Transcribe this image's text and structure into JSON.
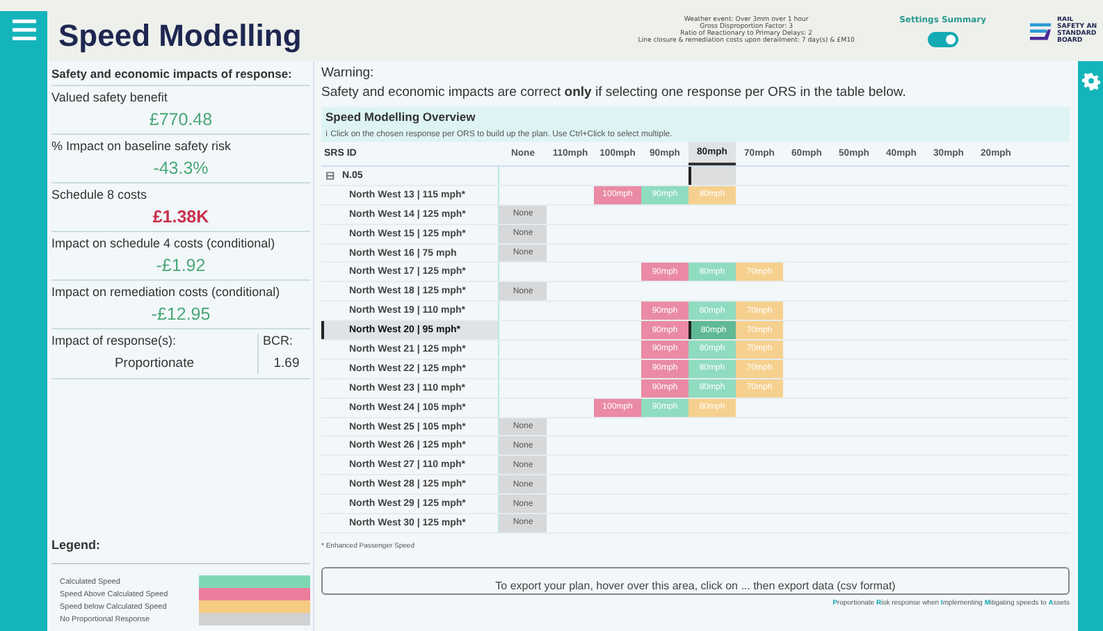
{
  "header": {
    "title": "Speed Modelling",
    "settings_lines": [
      "Weather event: Over 3mm over 1 hour",
      "Gross Disproportion Factor: 3",
      "Ratio of Reactionary to Primary Delays: 2",
      "Line closure & remediation costs upon derailment: 7 day(s) & £M10"
    ],
    "settings_label": "Settings Summary",
    "settings_toggle": {
      "on": true
    },
    "logo_lines": [
      "RAIL",
      "SAFETY AN",
      "STANDARD",
      "BOARD"
    ]
  },
  "impacts": {
    "title": "Safety and economic impacts of response:",
    "metrics": [
      {
        "label": "Valued safety benefit",
        "value": "£770.48",
        "adverse": false
      },
      {
        "label": "% Impact on baseline safety risk",
        "value": "-43.3%",
        "adverse": false
      },
      {
        "label": "Schedule 8 costs",
        "value": "£1.38K",
        "adverse": true
      },
      {
        "label": "Impact on schedule 4 costs (conditional)",
        "value": "-£1.92",
        "adverse": false
      },
      {
        "label": "Impact on remediation costs (conditional)",
        "value": "-£12.95",
        "adverse": false
      }
    ],
    "response_label": "Impact of response(s):",
    "response_value": "Proportionate",
    "bcr_label": "BCR:",
    "bcr_value": "1.69"
  },
  "legend": {
    "title": "Legend:",
    "items": [
      {
        "label": "Calculated Speed",
        "color": "#7fd8b4"
      },
      {
        "label": "Speed Above Calculated Speed",
        "color": "#ea7e9c"
      },
      {
        "label": "Speed below Calculated Speed",
        "color": "#f6cb82"
      },
      {
        "label": "No Proportional Response",
        "color": "#cfd1d3"
      }
    ]
  },
  "warning": {
    "title": "Warning:",
    "text": "Safety and economic impacts are correct **only** if selecting one response per ORS in the table below."
  },
  "overview": {
    "title": "Speed Modelling Overview",
    "hint": "ℹ Click on the chosen response per ORS to build up the plan. Use Ctrl+Click to select multiple.",
    "id_header": "SRS ID",
    "columns": [
      {
        "label": "None",
        "selected": false
      },
      {
        "label": "110mph",
        "selected": false
      },
      {
        "label": "100mph",
        "selected": false
      },
      {
        "label": "90mph",
        "selected": false
      },
      {
        "label": "80mph",
        "selected": true
      },
      {
        "label": "70mph",
        "selected": false
      },
      {
        "label": "60mph",
        "selected": false
      },
      {
        "label": "50mph",
        "selected": false
      },
      {
        "label": "40mph",
        "selected": false
      },
      {
        "label": "30mph",
        "selected": false
      },
      {
        "label": "20mph",
        "selected": false
      }
    ],
    "group": {
      "label": "N.05",
      "expanded": true,
      "toggle": "⊟",
      "cells": [
        {
          "kind": "blank"
        },
        {
          "kind": "blank"
        },
        {
          "kind": "blank"
        },
        {
          "kind": "blank"
        },
        {
          "kind": "focus"
        },
        {
          "kind": "blank"
        },
        {
          "kind": "blank"
        },
        {
          "kind": "blank"
        },
        {
          "kind": "blank"
        },
        {
          "kind": "blank"
        },
        {
          "kind": "blank"
        }
      ],
      "rows": [
        {
          "label": "North West 13 | 115 mph*",
          "selected": false,
          "cells": [
            {
              "kind": "blank"
            },
            {
              "kind": "blank"
            },
            {
              "kind": "above",
              "text": "100mph",
              "selected": false
            },
            {
              "kind": "calc",
              "text": "90mph",
              "selected": false
            },
            {
              "kind": "below",
              "text": "80mph",
              "selected": false
            },
            {
              "kind": "blank"
            },
            {
              "kind": "blank"
            },
            {
              "kind": "blank"
            },
            {
              "kind": "blank"
            },
            {
              "kind": "blank"
            },
            {
              "kind": "blank"
            }
          ]
        },
        {
          "label": "North West 14 | 125 mph*",
          "selected": false,
          "cells": [
            {
              "kind": "none",
              "text": "None",
              "selected": false
            }
          ]
        },
        {
          "label": "North West 15 | 125 mph*",
          "selected": false,
          "cells": [
            {
              "kind": "none",
              "text": "None",
              "selected": false
            }
          ]
        },
        {
          "label": "North West 16 | 75 mph",
          "selected": false,
          "cells": [
            {
              "kind": "none",
              "text": "None",
              "selected": false
            }
          ]
        },
        {
          "label": "North West 17 | 125 mph*",
          "selected": false,
          "cells": [
            {
              "kind": "blank"
            },
            {
              "kind": "blank"
            },
            {
              "kind": "blank"
            },
            {
              "kind": "above",
              "text": "90mph",
              "selected": false
            },
            {
              "kind": "calc",
              "text": "80mph",
              "selected": false
            },
            {
              "kind": "below",
              "text": "70mph",
              "selected": false
            }
          ]
        },
        {
          "label": "North West 18 | 125 mph*",
          "selected": false,
          "cells": [
            {
              "kind": "none",
              "text": "None",
              "selected": false
            }
          ]
        },
        {
          "label": "North West 19 | 110 mph*",
          "selected": false,
          "cells": [
            {
              "kind": "blank"
            },
            {
              "kind": "blank"
            },
            {
              "kind": "blank"
            },
            {
              "kind": "above",
              "text": "90mph",
              "selected": false
            },
            {
              "kind": "calc",
              "text": "80mph",
              "selected": false
            },
            {
              "kind": "below",
              "text": "70mph",
              "selected": false
            }
          ]
        },
        {
          "label": "North West 20 | 95 mph*",
          "selected": true,
          "cells": [
            {
              "kind": "blank"
            },
            {
              "kind": "blank"
            },
            {
              "kind": "blank"
            },
            {
              "kind": "above",
              "text": "90mph",
              "selected": false
            },
            {
              "kind": "calc",
              "text": "80mph",
              "selected": true
            },
            {
              "kind": "below",
              "text": "70mph",
              "selected": false
            }
          ]
        },
        {
          "label": "North West 21 | 125 mph*",
          "selected": false,
          "cells": [
            {
              "kind": "blank"
            },
            {
              "kind": "blank"
            },
            {
              "kind": "blank"
            },
            {
              "kind": "above",
              "text": "90mph",
              "selected": false
            },
            {
              "kind": "calc",
              "text": "80mph",
              "selected": false
            },
            {
              "kind": "below",
              "text": "70mph",
              "selected": false
            }
          ]
        },
        {
          "label": "North West 22 | 125 mph*",
          "selected": false,
          "cells": [
            {
              "kind": "blank"
            },
            {
              "kind": "blank"
            },
            {
              "kind": "blank"
            },
            {
              "kind": "above",
              "text": "90mph",
              "selected": false
            },
            {
              "kind": "calc",
              "text": "80mph",
              "selected": false
            },
            {
              "kind": "below",
              "text": "70mph",
              "selected": false
            }
          ]
        },
        {
          "label": "North West 23 | 110 mph*",
          "selected": false,
          "cells": [
            {
              "kind": "blank"
            },
            {
              "kind": "blank"
            },
            {
              "kind": "blank"
            },
            {
              "kind": "above",
              "text": "90mph",
              "selected": false
            },
            {
              "kind": "calc",
              "text": "80mph",
              "selected": false
            },
            {
              "kind": "below",
              "text": "70mph",
              "selected": false
            }
          ]
        },
        {
          "label": "North West 24 | 105 mph*",
          "selected": false,
          "cells": [
            {
              "kind": "blank"
            },
            {
              "kind": "blank"
            },
            {
              "kind": "above",
              "text": "100mph",
              "selected": false
            },
            {
              "kind": "calc",
              "text": "90mph",
              "selected": false
            },
            {
              "kind": "below",
              "text": "80mph",
              "selected": false
            }
          ]
        },
        {
          "label": "North West 25 | 105 mph*",
          "selected": false,
          "cells": [
            {
              "kind": "none",
              "text": "None",
              "selected": false
            }
          ]
        },
        {
          "label": "North West 26 | 125 mph*",
          "selected": false,
          "cells": [
            {
              "kind": "none",
              "text": "None",
              "selected": false
            }
          ]
        },
        {
          "label": "North West 27 | 110 mph*",
          "selected": false,
          "cells": [
            {
              "kind": "none",
              "text": "None",
              "selected": false
            }
          ]
        },
        {
          "label": "North West 28 | 125 mph*",
          "selected": false,
          "cells": [
            {
              "kind": "none",
              "text": "None",
              "selected": false
            }
          ]
        },
        {
          "label": "North West 29 | 125 mph*",
          "selected": false,
          "cells": [
            {
              "kind": "none",
              "text": "None",
              "selected": false
            }
          ]
        },
        {
          "label": "North West 30 | 125 mph*",
          "selected": false,
          "cells": [
            {
              "kind": "none",
              "text": "None",
              "selected": false
            }
          ]
        }
      ]
    },
    "footnote": "* Enhanced Passenger Speed"
  },
  "export_note": "To export your plan, hover over this area, click on ... then export data (csv format)",
  "footer": [
    {
      "text": "P",
      "kind": "accent"
    },
    {
      "text": "roportionate ",
      "kind": "plain"
    },
    {
      "text": "R",
      "kind": "accent"
    },
    {
      "text": "isk response when ",
      "kind": "plain"
    },
    {
      "text": "I",
      "kind": "accent"
    },
    {
      "text": "mplementing ",
      "kind": "plain"
    },
    {
      "text": "M",
      "kind": "accent"
    },
    {
      "text": "itigating speeds to ",
      "kind": "plain"
    },
    {
      "text": "A",
      "kind": "accent"
    },
    {
      "text": "ssets",
      "kind": "plain"
    }
  ]
}
